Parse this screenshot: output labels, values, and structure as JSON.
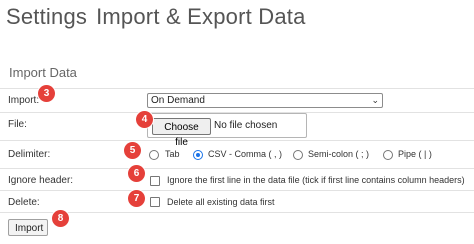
{
  "header": {
    "title_part1": "Settings",
    "title_part2": "Import & Export Data"
  },
  "section": {
    "title": "Import Data"
  },
  "form": {
    "import": {
      "label": "Import:",
      "selected": "On Demand",
      "badge": "3"
    },
    "file": {
      "label": "File:",
      "button_label": "Choose file",
      "status": "No file chosen",
      "badge": "4"
    },
    "delimiter": {
      "label": "Delimiter:",
      "badge": "5",
      "options": [
        {
          "label": "Tab",
          "checked": false
        },
        {
          "label": "CSV - Comma ( , )",
          "checked": true
        },
        {
          "label": "Semi-colon ( ; )",
          "checked": false
        },
        {
          "label": "Pipe ( | )",
          "checked": false
        }
      ]
    },
    "ignore_header": {
      "label": "Ignore header:",
      "option_label": "Ignore the first line in the data file (tick if first line contains column headers)",
      "checked": false,
      "badge": "6"
    },
    "delete": {
      "label": "Delete:",
      "option_label": "Delete all existing data first",
      "checked": false,
      "badge": "7"
    },
    "submit": {
      "label": "Import",
      "badge": "8"
    }
  },
  "colors": {
    "badge": "#e5403a",
    "radio_accent": "#1a73e8",
    "row_border": "#e2e2e2"
  }
}
